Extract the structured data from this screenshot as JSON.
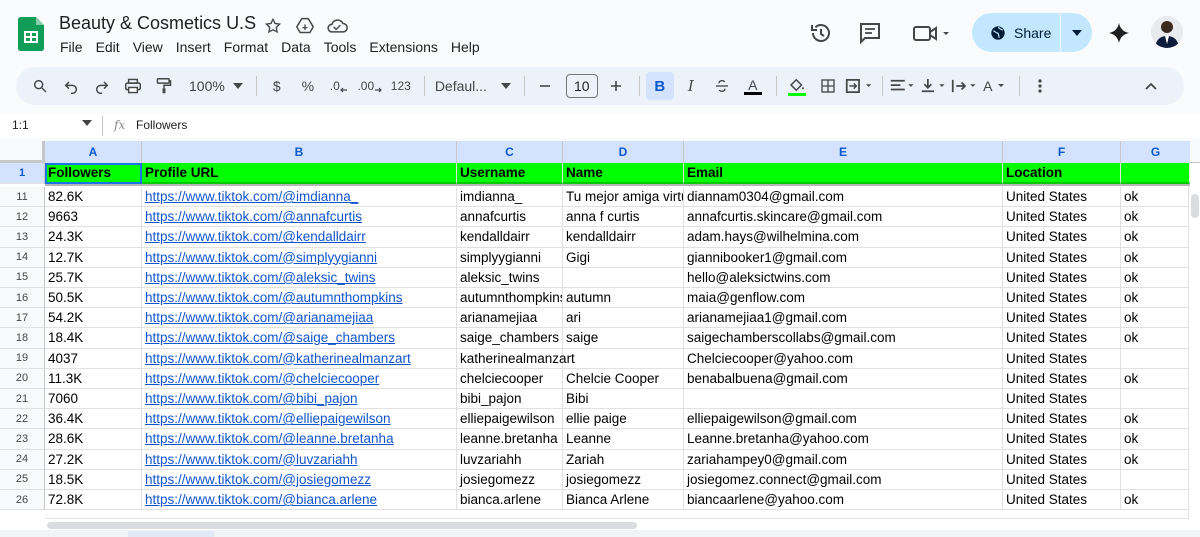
{
  "window": {
    "title": "Beauty & Cosmetics U.S",
    "menu": [
      "File",
      "Edit",
      "View",
      "Insert",
      "Format",
      "Data",
      "Tools",
      "Extensions",
      "Help"
    ],
    "share_label": "Share"
  },
  "toolbar": {
    "zoom": "100%",
    "currency": "$",
    "percent": "%",
    "decrease_decimal": ".0",
    "increase_decimal": ".00",
    "number_format": "123",
    "font_name": "Defaul...",
    "font_size": "10",
    "bold": "B",
    "italic": "I",
    "text_color": "A",
    "text_rotation": "A"
  },
  "formula_bar": {
    "name_box": "1:1",
    "fx": "fx",
    "value": "Followers"
  },
  "columns": [
    "A",
    "B",
    "C",
    "D",
    "E",
    "F",
    "G"
  ],
  "header_row": {
    "number": "1",
    "cells": [
      "Followers",
      "Profile URL",
      "Username",
      "Name",
      "Email",
      "Location",
      ""
    ]
  },
  "rows": [
    {
      "n": "11",
      "cells": [
        "82.6K",
        "https://www.tiktok.com/@imdianna_",
        "imdianna_",
        "Tu mejor amiga virtual",
        "diannam0304@gmail.com",
        "United States",
        "ok"
      ]
    },
    {
      "n": "12",
      "cells": [
        "9663",
        "https://www.tiktok.com/@annafcurtis",
        "annafcurtis",
        "anna f curtis",
        "annafcurtis.skincare@gmail.com",
        "United States",
        "ok"
      ]
    },
    {
      "n": "13",
      "cells": [
        "24.3K",
        "https://www.tiktok.com/@kendalldairr",
        "kendalldairr",
        "kendalldairr",
        "adam.hays@wilhelmina.com",
        "United States",
        "ok"
      ]
    },
    {
      "n": "14",
      "cells": [
        "12.7K",
        "https://www.tiktok.com/@simplyygianni",
        "simplyygianni",
        "Gigi",
        "giannibooker1@gmail.com",
        "United States",
        "ok"
      ]
    },
    {
      "n": "15",
      "cells": [
        "25.7K",
        "https://www.tiktok.com/@aleksic_twins",
        "aleksic_twins",
        "",
        "hello@aleksictwins.com",
        "United States",
        "ok"
      ]
    },
    {
      "n": "16",
      "cells": [
        "50.5K",
        "https://www.tiktok.com/@autumnthompkins",
        "autumnthompkins",
        "autumn",
        "maia@genflow.com",
        "United States",
        "ok"
      ]
    },
    {
      "n": "17",
      "cells": [
        "54.2K",
        "https://www.tiktok.com/@arianamejiaa",
        "arianamejiaa",
        "ari",
        "arianamejiaa1@gmail.com",
        "United States",
        "ok"
      ]
    },
    {
      "n": "18",
      "cells": [
        "18.4K",
        "https://www.tiktok.com/@saige_chambers",
        "saige_chambers",
        "saige",
        "saigechamberscollabs@gmail.com",
        "United States",
        "ok"
      ]
    },
    {
      "n": "19",
      "cells": [
        "4037",
        "https://www.tiktok.com/@katherinealmanzart",
        "katherinealmanzart",
        "",
        "Chelciecooper@yahoo.com",
        "United States",
        ""
      ]
    },
    {
      "n": "20",
      "cells": [
        "11.3K",
        "https://www.tiktok.com/@chelciecooper",
        "chelciecooper",
        "Chelcie Cooper",
        "benabalbuena@gmail.com",
        "United States",
        "ok"
      ]
    },
    {
      "n": "21",
      "cells": [
        "7060",
        "https://www.tiktok.com/@bibi_pajon",
        "bibi_pajon",
        "Bibi",
        "",
        "United States",
        ""
      ]
    },
    {
      "n": "22",
      "cells": [
        "36.4K",
        "https://www.tiktok.com/@elliepaigewilson",
        "elliepaigewilson",
        "ellie paige",
        "elliepaigewilson@gmail.com",
        "United States",
        "ok"
      ]
    },
    {
      "n": "23",
      "cells": [
        "28.6K",
        "https://www.tiktok.com/@leanne.bretanha",
        "leanne.bretanha",
        "Leanne",
        "Leanne.bretanha@yahoo.com",
        "United States",
        "ok"
      ]
    },
    {
      "n": "24",
      "cells": [
        "27.2K",
        "https://www.tiktok.com/@luvzariahh",
        "luvzariahh",
        "Zariah",
        "zariahampey0@gmail.com",
        "United States",
        "ok"
      ]
    },
    {
      "n": "25",
      "cells": [
        "18.5K",
        "https://www.tiktok.com/@josiegomezz",
        "josiegomezz",
        "josiegomezz",
        "josiegomez.connect@gmail.com",
        "United States",
        ""
      ]
    },
    {
      "n": "26",
      "cells": [
        "72.8K",
        "https://www.tiktok.com/@bianca.arlene",
        "bianca.arlene",
        "Bianca Arlene",
        "biancaarlene@yahoo.com",
        "United States",
        "ok"
      ]
    }
  ],
  "colors": {
    "header_fill": "#00ff00",
    "link": "#1155cc",
    "share_bg": "#c2e7ff",
    "selection": "#d3e3fd"
  }
}
